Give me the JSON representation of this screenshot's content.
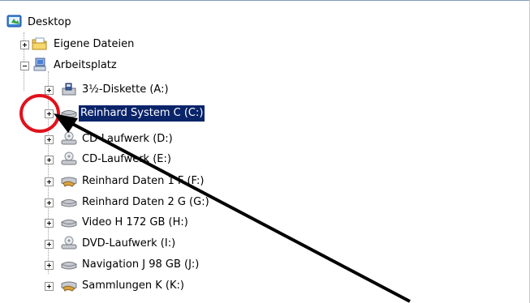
{
  "tree": {
    "root": {
      "label": "Desktop",
      "icon": "desktop-icon"
    },
    "items": [
      {
        "label": "Eigene Dateien",
        "icon": "folder-documents-icon",
        "expander": "plus"
      },
      {
        "label": "Arbeitsplatz",
        "icon": "my-computer-icon",
        "expander": "minus"
      }
    ],
    "drives": [
      {
        "label": "3½-Diskette (A:)",
        "icon": "floppy-drive-icon"
      },
      {
        "label": "Reinhard System C (C:)",
        "icon": "hard-drive-icon",
        "selected": true
      },
      {
        "label": "CD-Laufwerk (D:)",
        "icon": "cd-drive-icon"
      },
      {
        "label": "CD-Laufwerk (E:)",
        "icon": "cd-drive-icon"
      },
      {
        "label": "Reinhard Daten 1 F (F:)",
        "icon": "shared-drive-icon"
      },
      {
        "label": "Reinhard Daten 2 G (G:)",
        "icon": "hard-drive-icon"
      },
      {
        "label": "Video H 172 GB (H:)",
        "icon": "hard-drive-icon"
      },
      {
        "label": "DVD-Laufwerk (I:)",
        "icon": "cd-drive-icon"
      },
      {
        "label": "Navigation J 98 GB (J:)",
        "icon": "hard-drive-icon"
      },
      {
        "label": "Sammlungen  K (K:)",
        "icon": "shared-drive-icon"
      }
    ]
  },
  "annotation": {
    "circle_color": "#e0121c",
    "arrow_color": "#000000"
  },
  "colors": {
    "selection": "#0a246a"
  }
}
